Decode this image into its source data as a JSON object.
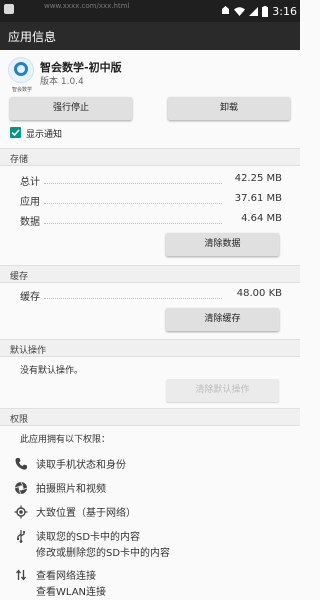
{
  "status_bar": {
    "faint_text": "www.xxxx.com/xxx.html",
    "time": "3:16",
    "icons": [
      "notification-icon",
      "wifi-icon",
      "signal-icon",
      "battery-icon"
    ]
  },
  "app_bar": {
    "title": "应用信息"
  },
  "app": {
    "name": "智会数学-初中版",
    "version": "版本 1.0.4",
    "icon_caption": "智会数学"
  },
  "actions": {
    "force_stop": "强行停止",
    "uninstall": "卸载"
  },
  "notifications": {
    "label": "显示通知",
    "checked": true
  },
  "storage": {
    "header": "存储",
    "rows": [
      {
        "label": "总计",
        "value": "42.25 MB"
      },
      {
        "label": "应用",
        "value": "37.61 MB"
      },
      {
        "label": "数据",
        "value": "4.64 MB"
      }
    ],
    "clear_data": "清除数据"
  },
  "cache": {
    "header": "缓存",
    "label": "缓存",
    "value": "48.00 KB",
    "clear_cache": "清除缓存"
  },
  "defaults": {
    "header": "默认操作",
    "text": "没有默认操作。",
    "clear_defaults": "清除默认操作"
  },
  "permissions": {
    "header": "权限",
    "intro": "此应用拥有以下权限：",
    "items": [
      {
        "icon": "phone-icon",
        "lines": [
          "读取手机状态和身份"
        ]
      },
      {
        "icon": "camera-icon",
        "lines": [
          "拍摄照片和视频"
        ]
      },
      {
        "icon": "location-icon",
        "lines": [
          "大致位置（基于网络）"
        ]
      },
      {
        "icon": "usb-storage-icon",
        "lines": [
          "读取您的SD卡中的内容",
          "修改或删除您的SD卡中的内容"
        ]
      },
      {
        "icon": "network-icon",
        "lines": [
          "查看网络连接",
          "查看WLAN连接"
        ]
      }
    ]
  },
  "colors": {
    "accent": "#009688",
    "status_bar": "#1f1f1f",
    "app_bar": "#2a2a2a",
    "app_icon_blue": "#1f7fd1"
  }
}
